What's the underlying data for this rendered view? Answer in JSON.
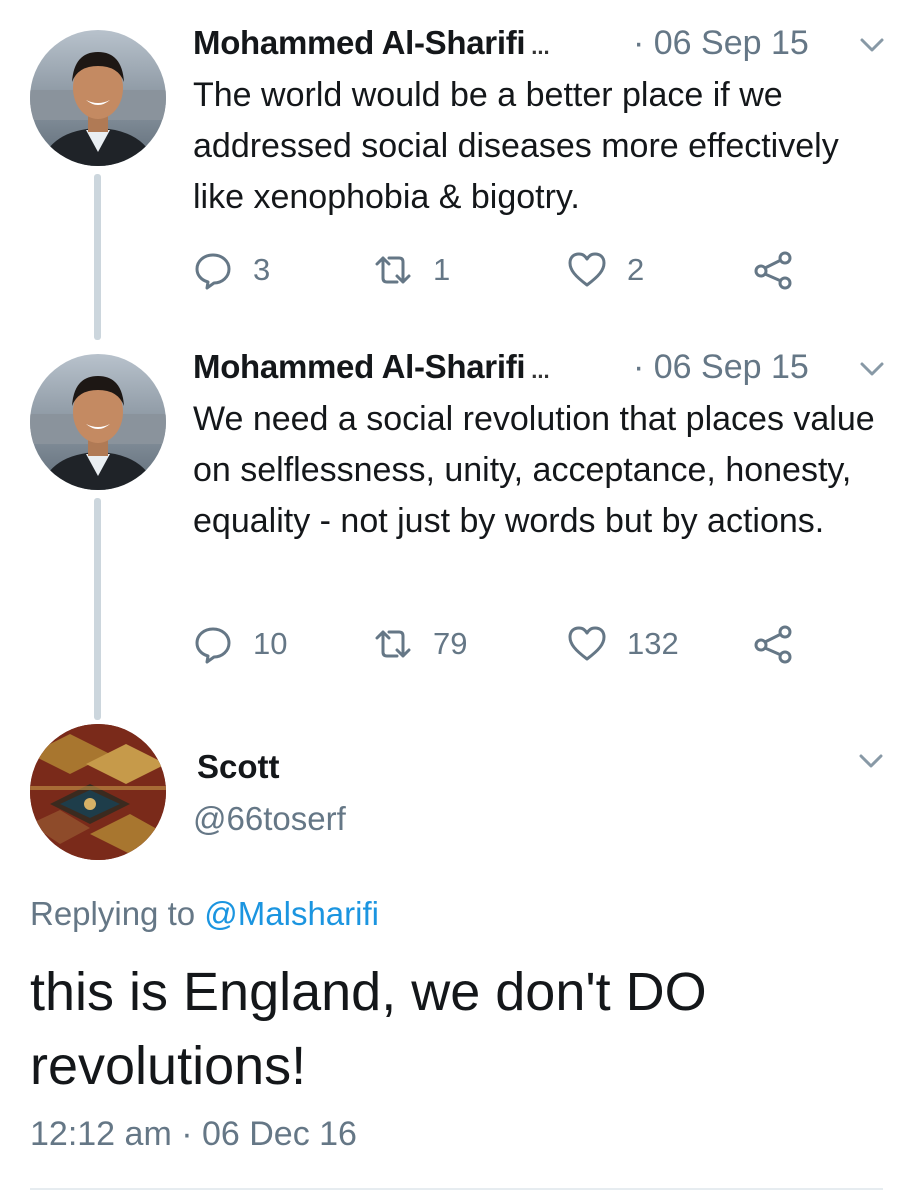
{
  "tweets": [
    {
      "author": "Mohammed Al-Sharifi",
      "ellipsis": "...",
      "date": "· 06 Sep 15",
      "text": "The world would be a better place if we addressed social diseases more effectively like xenophobia & bigotry.",
      "replies": "3",
      "retweets": "1",
      "likes": "2"
    },
    {
      "author": "Mohammed Al-Sharifi",
      "ellipsis": "...",
      "date": "· 06 Sep 15",
      "text": "We need a social revolution that places value on selflessness, unity, acceptance, honesty, equality - not just by words but by actions.",
      "replies": "10",
      "retweets": "79",
      "likes": "132"
    }
  ],
  "reply": {
    "name": "Scott",
    "handle": "@66toserf",
    "replying_label": "Replying to ",
    "replying_mention": "@Malsharifi",
    "text": "this is England, we don't DO revolutions!",
    "timestamp": "12:12 am · 06 Dec 16"
  },
  "icons": {
    "reply": "reply-icon",
    "retweet": "retweet-icon",
    "like": "heart-icon",
    "share": "share-icon",
    "more": "chevron-down-icon"
  },
  "colors": {
    "text": "#14171a",
    "muted": "#657786",
    "link": "#1b95e0",
    "thread_line": "#ccd6dd"
  }
}
